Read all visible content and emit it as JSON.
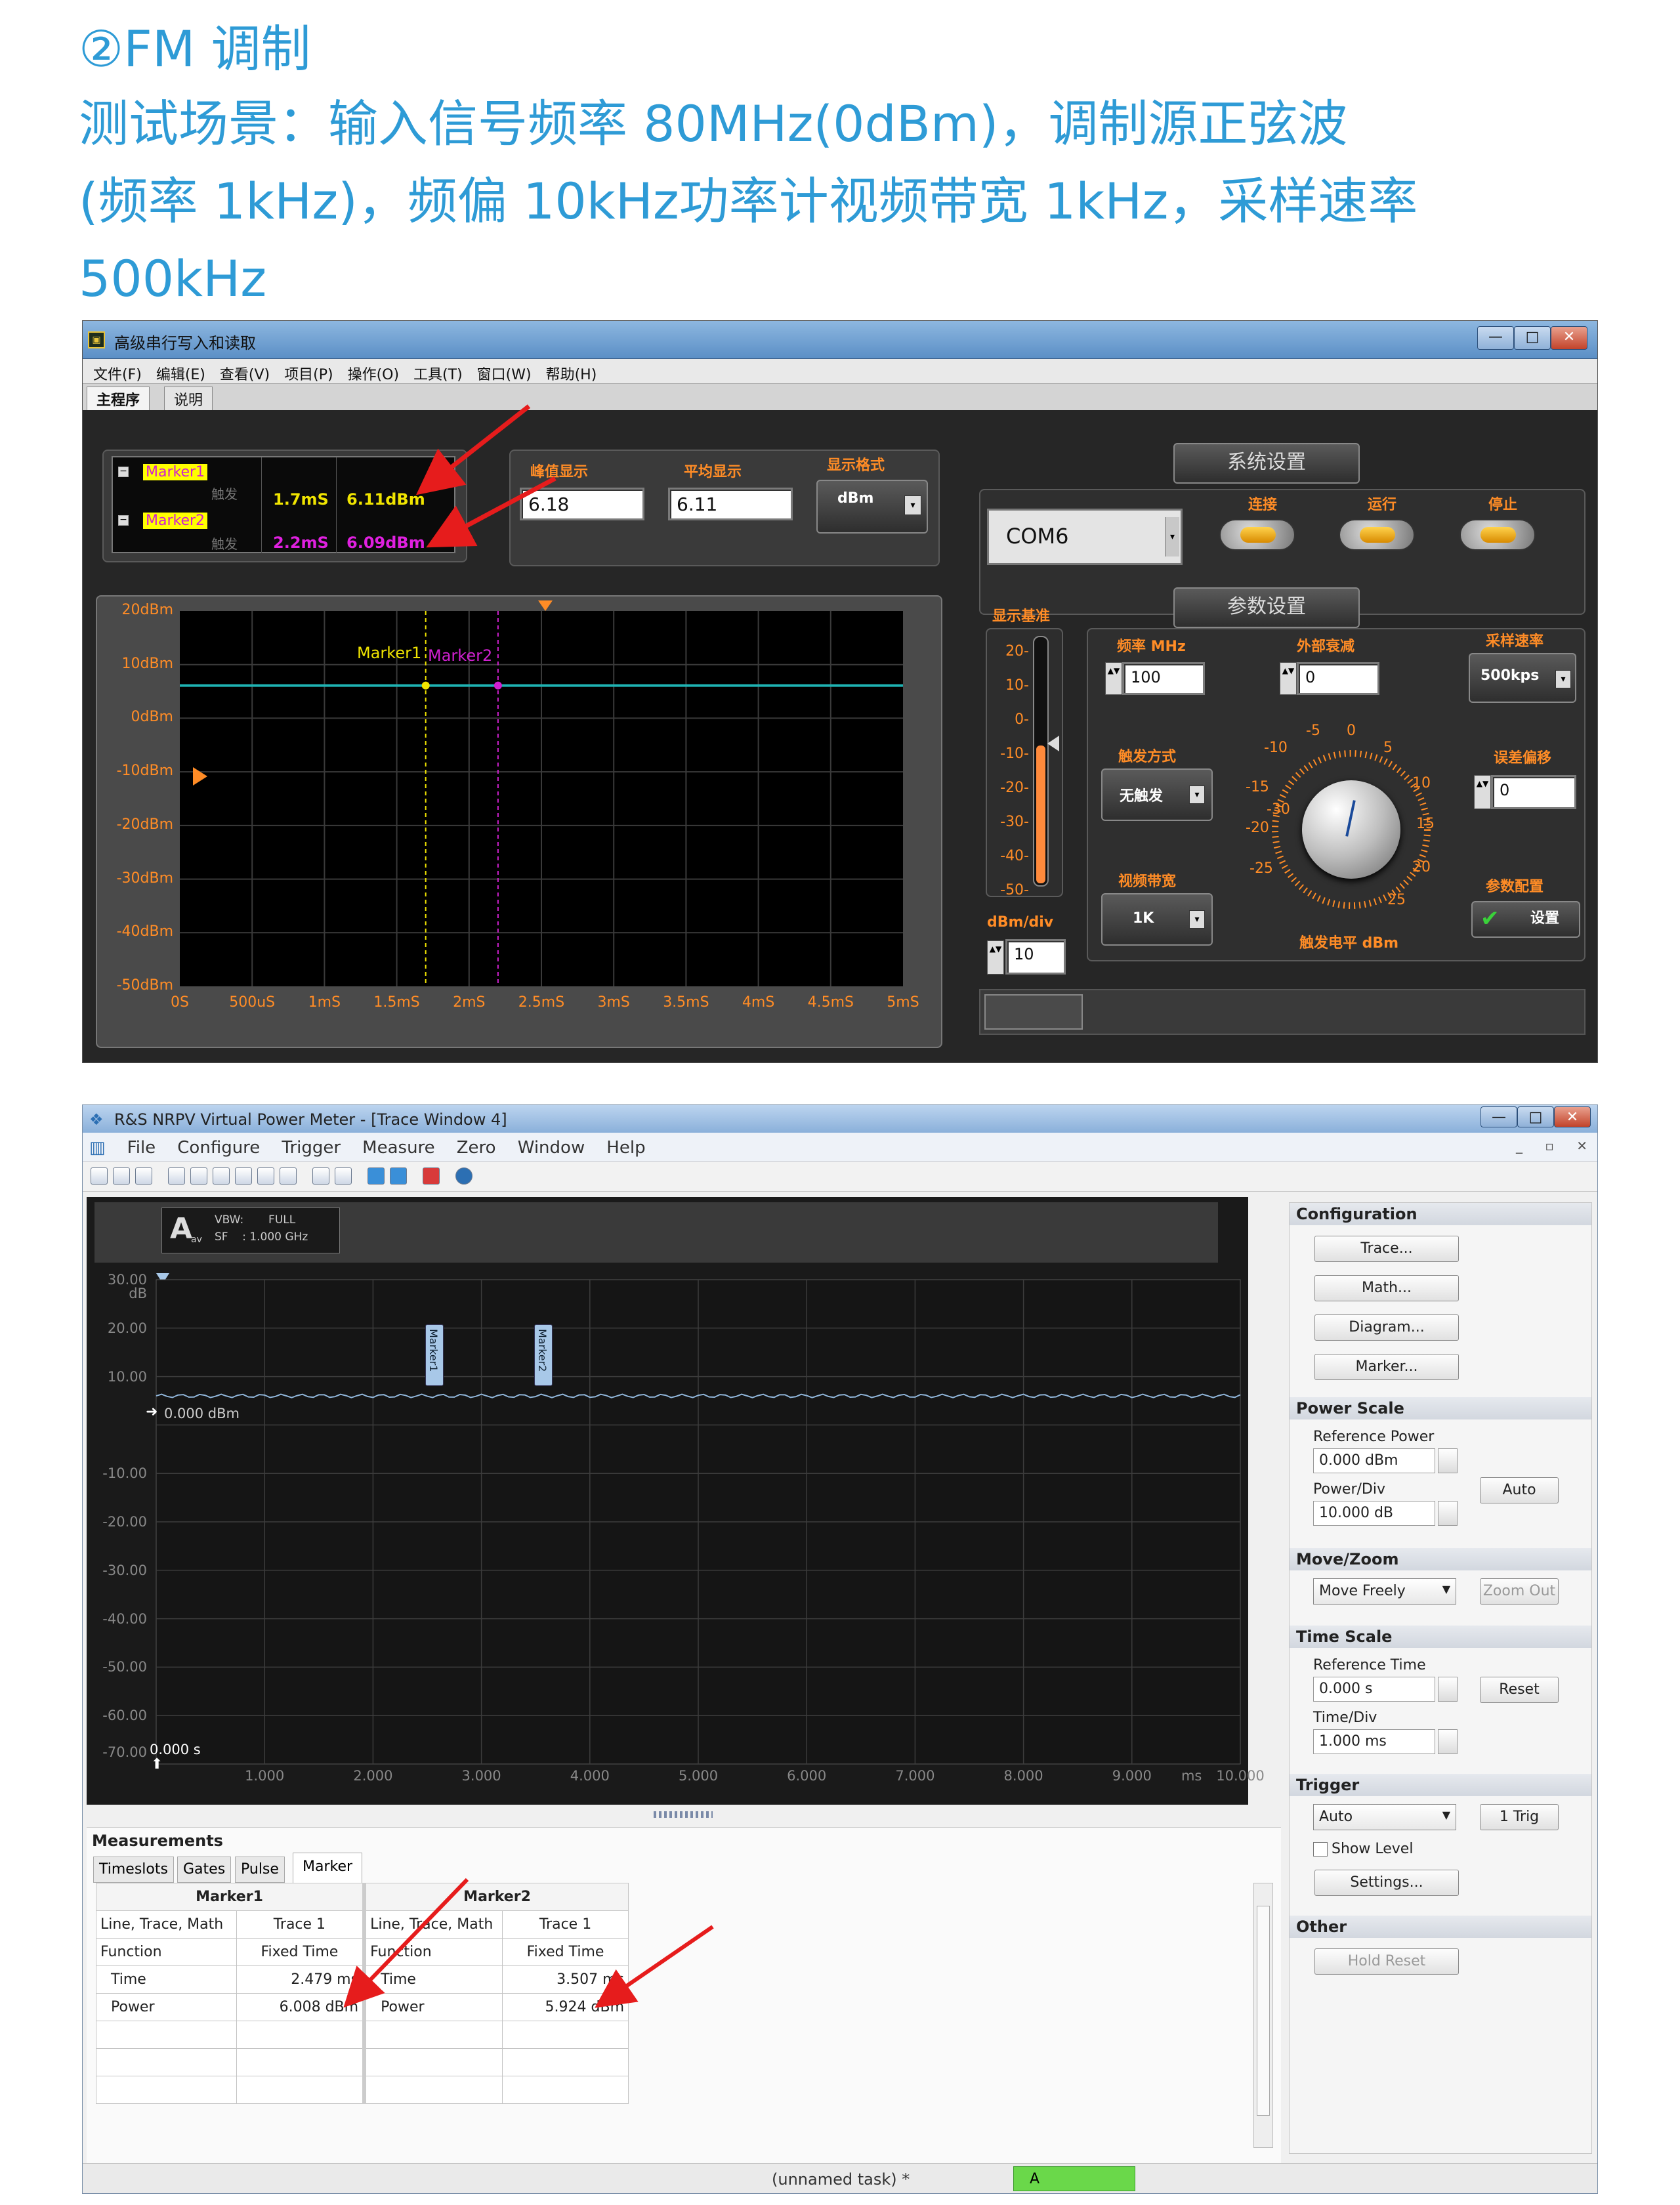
{
  "header": {
    "line1": "②FM 调制",
    "line2": "测试场景：输入信号频率 80MHz(0dBm)，调制源正弦波",
    "line3": "(频率 1kHz)，频偏 10kHz功率计视频带宽 1kHz，采样速率",
    "line4": "500kHz"
  },
  "labview": {
    "title": "高级串行写入和读取",
    "menu": [
      "文件(F)",
      "编辑(E)",
      "查看(V)",
      "项目(P)",
      "操作(O)",
      "工具(T)",
      "窗口(W)",
      "帮助(H)"
    ],
    "tabs": [
      "主程序",
      "说明"
    ],
    "marker_tree": {
      "m1_label": "Marker1",
      "m1_sub": "触发",
      "m1_time": "1.7mS",
      "m1_value": "6.11dBm",
      "m2_label": "Marker2",
      "m2_sub": "触发",
      "m2_time": "2.2mS",
      "m2_value": "6.09dBm"
    },
    "peak_label": "峰值显示",
    "peak_value": "6.18",
    "avg_label": "平均显示",
    "avg_value": "6.11",
    "format_label": "显示格式",
    "format_value": "dBm",
    "system_settings": "系统设置",
    "com_port": "COM6",
    "connect_label": "连接",
    "run_label": "运行",
    "stop_label": "停止",
    "param_settings": "参数设置",
    "display_ref_label": "显示基准",
    "display_ref_ticks": [
      "20-",
      "10-",
      "0-",
      "-10-",
      "-20-",
      "-30-",
      "-40-",
      "-50-"
    ],
    "dbm_div_label": "dBm/div",
    "dbm_div_value": "10",
    "freq_label": "频率 MHz",
    "freq_value": "100",
    "ext_att_label": "外部衰减",
    "ext_att_value": "0",
    "sample_rate_label": "采样速率",
    "sample_rate_value": "500kps",
    "trigger_mode_label": "触发方式",
    "trigger_mode_value": "无触发",
    "offset_label": "误差偏移",
    "offset_value": "0",
    "vbw_label": "视频带宽",
    "vbw_value": "1K",
    "param_config_label": "参数配置",
    "set_button": "设置",
    "knob_label": "触发电平 dBm",
    "knob_ticks": [
      "-30",
      "-25",
      "-20",
      "-15",
      "-10",
      "-5",
      "0",
      "5",
      "10",
      "15",
      "20",
      "25"
    ],
    "chart": {
      "y_ticks": [
        "20dBm",
        "10dBm",
        "0dBm",
        "-10dBm",
        "-20dBm",
        "-30dBm",
        "-40dBm",
        "-50dBm"
      ],
      "x_ticks": [
        "0S",
        "500uS",
        "1mS",
        "1.5mS",
        "2mS",
        "2.5mS",
        "3mS",
        "3.5mS",
        "4mS",
        "4.5mS",
        "5mS"
      ],
      "marker1": "Marker1",
      "marker2": "Marker2"
    }
  },
  "rs": {
    "title": "R&S  NRPV Virtual Power Meter - [Trace Window 4]",
    "menu": [
      "File",
      "Configure",
      "Trigger",
      "Measure",
      "Zero",
      "Window",
      "Help"
    ],
    "info_channel": "A",
    "info_sub": "av",
    "info_line1": "VBW:       FULL",
    "info_line2": "SF    : 1.000 GHz",
    "ref_label": "0.000 dBm",
    "time_origin": "0.000 s",
    "y_ticks": [
      "30.00",
      "dB",
      "20.00",
      "10.00",
      "-10.00",
      "-20.00",
      "-30.00",
      "-40.00",
      "-50.00",
      "-60.00",
      "-70.00"
    ],
    "x_ticks": [
      "1.000",
      "2.000",
      "3.000",
      "4.000",
      "5.000",
      "6.000",
      "7.000",
      "8.000",
      "9.000",
      "ms",
      "10.000"
    ],
    "marker1": "Marker1",
    "marker2": "Marker2",
    "config": {
      "heading": "Configuration",
      "buttons": [
        "Trace...",
        "Math...",
        "Diagram...",
        "Marker..."
      ]
    },
    "power_scale": {
      "heading": "Power Scale",
      "ref_power_label": "Reference Power",
      "ref_power_value": "0.000 dBm",
      "power_div_label": "Power/Div",
      "power_div_value": "10.000 dB",
      "auto": "Auto"
    },
    "move_zoom": {
      "heading": "Move/Zoom",
      "mode": "Move Freely",
      "zoom_out": "Zoom Out"
    },
    "time_scale": {
      "heading": "Time Scale",
      "ref_time_label": "Reference Time",
      "ref_time_value": "0.000 s",
      "time_div_label": "Time/Div",
      "time_div_value": "1.000 ms",
      "reset": "Reset"
    },
    "trigger": {
      "heading": "Trigger",
      "mode": "Auto",
      "trig": "1 Trig",
      "show_level": "Show Level",
      "settings": "Settings..."
    },
    "other": {
      "heading": "Other",
      "hold_reset": "Hold Reset"
    },
    "measurements": {
      "heading": "Measurements",
      "tabs": [
        "Timeslots",
        "Gates",
        "Pulse",
        "Marker"
      ],
      "m1_header": "Marker1",
      "m2_header": "Marker2",
      "rows": [
        {
          "l1": "Line, Trace, Math",
          "v1": "Trace 1",
          "l2": "Line, Trace, Math",
          "v2": "Trace 1"
        },
        {
          "l1": "Function",
          "v1": "Fixed Time",
          "l2": "Function",
          "v2": "Fixed Time"
        },
        {
          "l1": "Time",
          "v1": "2.479 ms",
          "l2": "Time",
          "v2": "3.507 ms"
        },
        {
          "l1": "Power",
          "v1": "6.008 dBm",
          "l2": "Power",
          "v2": "5.924 dBm"
        }
      ]
    },
    "status_task": "(unnamed task) *",
    "status_channel": "A"
  }
}
